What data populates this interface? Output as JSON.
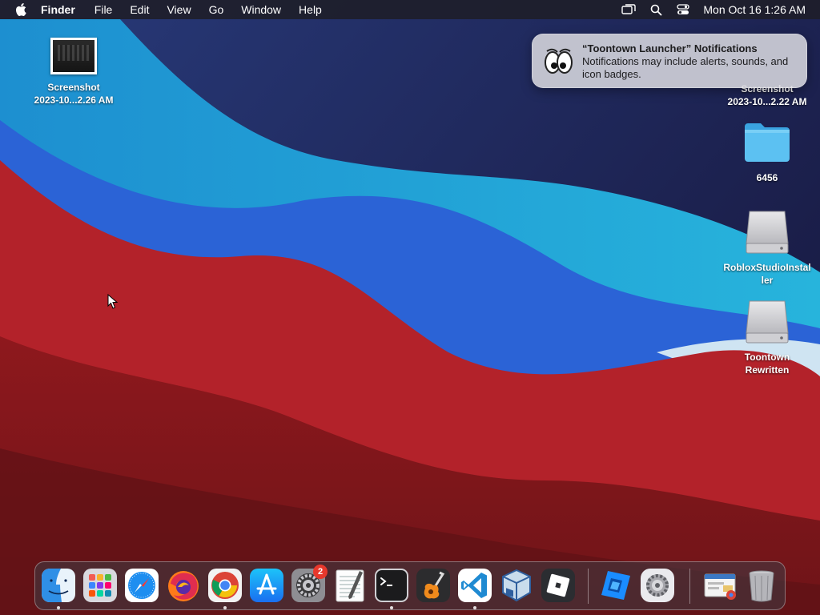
{
  "menubar": {
    "apple_icon": "apple-logo-icon",
    "app_name": "Finder",
    "menus": [
      "File",
      "Edit",
      "View",
      "Go",
      "Window",
      "Help"
    ],
    "status_icons": [
      "screen-mirroring-icon",
      "spotlight-search-icon",
      "control-center-icon"
    ],
    "clock": "Mon Oct 16  1:26 AM"
  },
  "desktop": {
    "left_icons": [
      {
        "label_line1": "Screenshot",
        "label_line2": "2023-10...2.26 AM",
        "icon": "screenshot-thumbnail"
      }
    ],
    "right_icons": [
      {
        "label_line1": "Screenshot",
        "label_line2": "2023-10...2.22 AM",
        "icon": "screenshot-thumbnail"
      },
      {
        "label_line1": "6456",
        "label_line2": "",
        "icon": "folder-icon"
      },
      {
        "label_line1": "RobloxStudioInstal",
        "label_line2": "ler",
        "icon": "disk-image-icon"
      },
      {
        "label_line1": "Toontown",
        "label_line2": "Rewritten",
        "icon": "disk-image-icon"
      }
    ]
  },
  "notification": {
    "title": "“Toontown Launcher” Notifications",
    "body": "Notifications may include alerts, sounds, and icon badges.",
    "icon": "toontown-eyes-icon"
  },
  "dock": {
    "items": [
      {
        "name": "Finder",
        "icon": "finder-icon",
        "running": true
      },
      {
        "name": "Launchpad",
        "icon": "launchpad-icon",
        "running": false
      },
      {
        "name": "Safari",
        "icon": "safari-icon",
        "running": false
      },
      {
        "name": "Firefox",
        "icon": "firefox-icon",
        "running": false
      },
      {
        "name": "Google Chrome",
        "icon": "chrome-icon",
        "running": true
      },
      {
        "name": "App Store",
        "icon": "app-store-icon",
        "running": false
      },
      {
        "name": "System Settings",
        "icon": "system-settings-icon",
        "running": false,
        "badge": "2"
      },
      {
        "name": "TextEdit",
        "icon": "textedit-icon",
        "running": false
      },
      {
        "name": "Terminal",
        "icon": "terminal-icon",
        "running": true
      },
      {
        "name": "GarageBand",
        "icon": "garageband-icon",
        "running": false
      },
      {
        "name": "Visual Studio Code",
        "icon": "vscode-icon",
        "running": true
      },
      {
        "name": "VirtualBox",
        "icon": "virtualbox-icon",
        "running": false
      },
      {
        "name": "Roblox",
        "icon": "roblox-icon",
        "running": false
      },
      {
        "name": "Roblox Studio",
        "icon": "roblox-studio-icon",
        "running": false
      },
      {
        "name": "Settings Utility",
        "icon": "gear-utility-icon",
        "running": false
      },
      {
        "name": "Downloads",
        "icon": "downloads-stack-icon",
        "running": false
      },
      {
        "name": "Trash",
        "icon": "trash-icon",
        "running": false
      }
    ]
  },
  "colors": {
    "menubar_bg": "#1e1e2a",
    "wallpaper_navy": "#1f2458",
    "wallpaper_cyan": "#22a6d6",
    "wallpaper_blue": "#2a6ad8",
    "wallpaper_red": "#b01f23",
    "badge_red": "#e8382c"
  }
}
